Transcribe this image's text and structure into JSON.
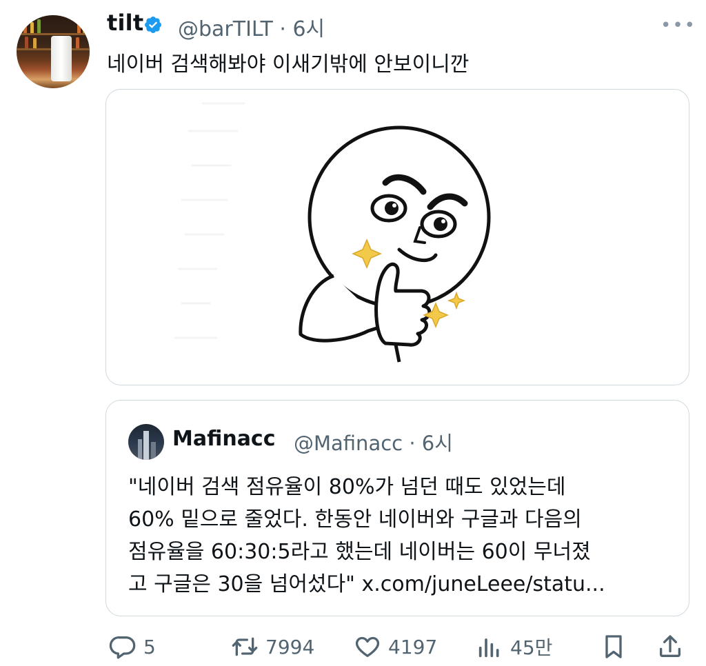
{
  "tweet": {
    "author_name": "tilt",
    "handle_time": "@barTILT · 6시",
    "text": "네이버 검색해봐야 이새기밖에 안보이니깐",
    "more": "•••"
  },
  "quote": {
    "author_name": "Mafinacc",
    "handle_time": "@Mafinacc · 6시",
    "lines": [
      "\"네이버 검색 점유율이 80%가 넘던 때도 있었는데",
      "60% 밑으로 줄었다. 한동안 네이버와 구글과 다음의",
      "점유율을 60:30:5라고 했는데 네이버는 60이 무너졌",
      "고 구글은 30을 넘어섰다\" x.com/juneLeee/statu..."
    ]
  },
  "actions": {
    "reply_count": "5",
    "retweet_count": "7994",
    "like_count": "4197",
    "views_count": "45만"
  },
  "icons": {
    "verified": "verified-badge-icon",
    "more": "more-dots-icon",
    "reply": "reply-icon",
    "retweet": "retweet-icon",
    "like": "heart-icon",
    "views": "views-chart-icon",
    "bookmark": "bookmark-icon",
    "share": "share-icon"
  },
  "colors": {
    "verified": "#1d9bf0",
    "muted": "#536471",
    "sparkle": "#f3c94a"
  }
}
